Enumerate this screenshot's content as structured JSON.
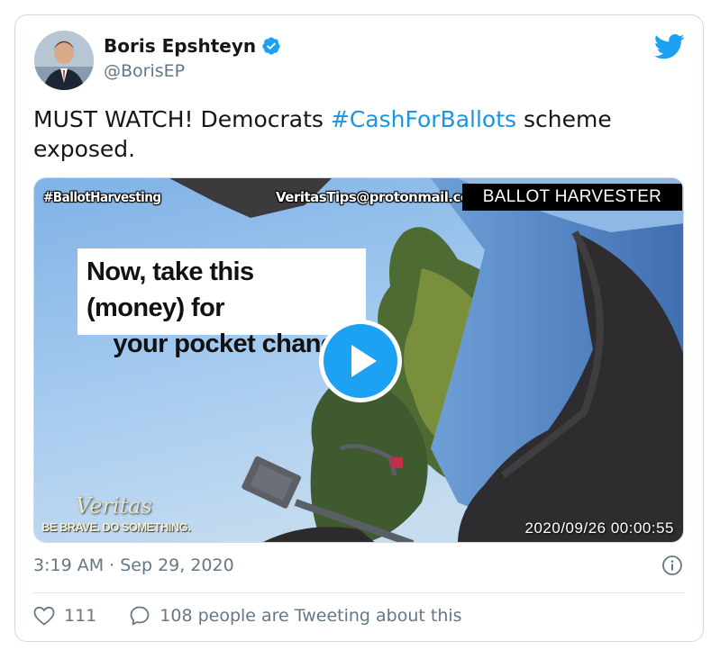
{
  "author": {
    "display_name": "Boris Epshteyn",
    "handle": "@BorisEP",
    "verified": true
  },
  "tweet": {
    "text_before": "MUST WATCH! Democrats ",
    "hashtag": "#CashForBallots",
    "text_after": " scheme exposed.",
    "timestamp": "3:19 AM · Sep 29, 2020"
  },
  "media": {
    "overlay_hashtag": "#BallotHarvesting",
    "overlay_email": "VeritasTips@protonmail.com",
    "overlay_label": "BALLOT HARVESTER",
    "caption_line1": "Now, take this (money) for",
    "caption_line2": "your pocket change.",
    "brand_name": "Veritas",
    "brand_tagline": "BE BRAVE. DO SOMETHING.",
    "video_timestamp": "2020/09/26 00:00:55"
  },
  "actions": {
    "likes": "111",
    "conversation": "108 people are Tweeting about this"
  },
  "colors": {
    "accent": "#1da1f2",
    "hashtag": "#1b95e0",
    "muted": "#657786"
  },
  "icons": [
    "verified-badge-icon",
    "twitter-bird-icon",
    "play-icon",
    "info-icon",
    "heart-icon",
    "speech-bubble-icon"
  ]
}
